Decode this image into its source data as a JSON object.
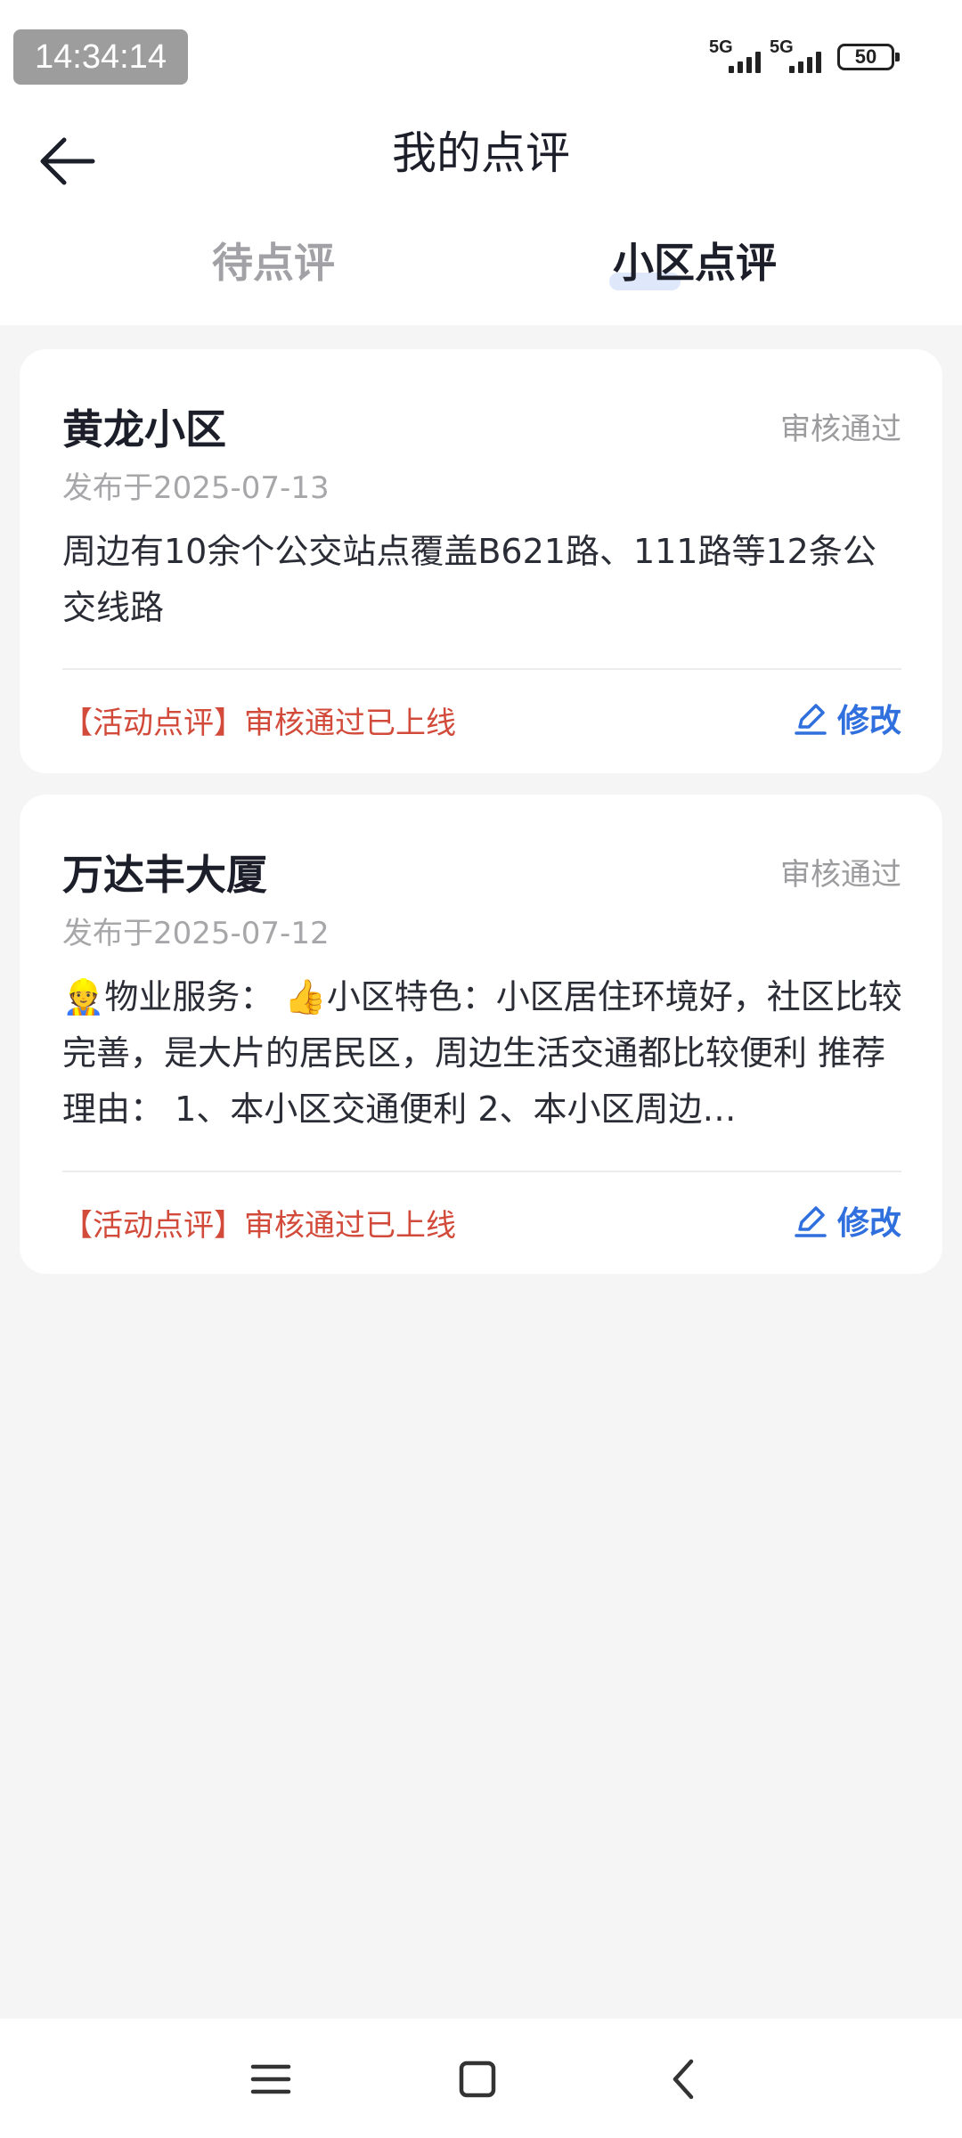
{
  "status_bar": {
    "time": "14:34:14",
    "network_1": "5G",
    "network_2": "5G",
    "battery": "50"
  },
  "header": {
    "title": "我的点评",
    "back_icon": "arrow-left-icon",
    "tabs": [
      {
        "label": "待点评",
        "active": false
      },
      {
        "label": "小区点评",
        "active": true
      }
    ]
  },
  "reviews": [
    {
      "name": "黄龙小区",
      "status": "审核通过",
      "date": "发布于2025-07-13",
      "content": "周边有10余个公交站点覆盖B621路、111路等12条公交线路",
      "note": "【活动点评】审核通过已上线",
      "edit_label": "修改"
    },
    {
      "name": "万达丰大厦",
      "status": "审核通过",
      "date": "发布于2025-07-12",
      "content": "👷物业服务： 👍小区特色：小区居住环境好，社区比较完善，是大片的居民区，周边生活交通都比较便利 推荐理由： 1、本小区交通便利 2、本小区周边…",
      "note": "【活动点评】审核通过已上线",
      "edit_label": "修改"
    }
  ],
  "navbar": {
    "icons": [
      "menu-icon",
      "home-square-icon",
      "back-chevron-icon"
    ]
  },
  "colors": {
    "accent": "#2f6fde",
    "note_red": "#d24a3a",
    "background": "#f5f5f6"
  }
}
